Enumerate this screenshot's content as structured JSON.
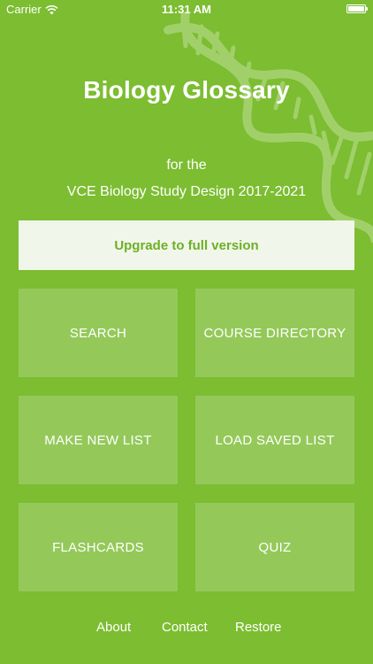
{
  "status_bar": {
    "carrier": "Carrier",
    "time": "11:31 AM"
  },
  "header": {
    "title": "Biology Glossary",
    "subtitle_line1": "for the",
    "subtitle_line2": "VCE Biology Study Design 2017-2021"
  },
  "upgrade_button": "Upgrade to full version",
  "menu": {
    "search": "SEARCH",
    "course_directory": "COURSE DIRECTORY",
    "make_new_list": "MAKE NEW LIST",
    "load_saved_list": "LOAD SAVED LIST",
    "flashcards": "FLASHCARDS",
    "quiz": "QUIZ"
  },
  "footer": {
    "about": "About",
    "contact": "Contact",
    "restore": "Restore"
  },
  "colors": {
    "background": "#7cbd31",
    "tile": "#94c95a",
    "upgrade_bg": "#f1f6ea",
    "upgrade_text": "#6db026"
  },
  "icons": [
    "wifi-icon",
    "battery-icon",
    "dna-helix-icon"
  ]
}
